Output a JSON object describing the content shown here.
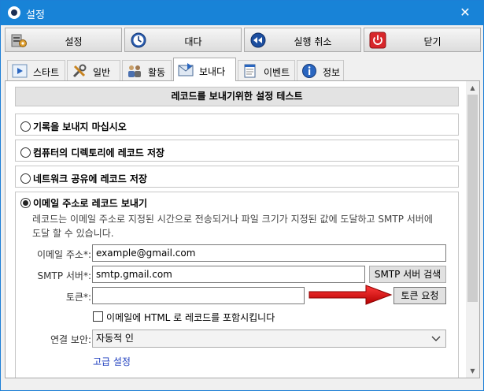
{
  "window": {
    "title": "설정",
    "close_glyph": "✕"
  },
  "toolbar": {
    "buttons": [
      {
        "label": "설정",
        "icon": "settings-icon"
      },
      {
        "label": "대다",
        "icon": "clock-icon"
      },
      {
        "label": "실행 취소",
        "icon": "rewind-icon"
      },
      {
        "label": "닫기",
        "icon": "power-icon"
      }
    ]
  },
  "tabs": [
    {
      "label": "스타트",
      "icon": "play-icon"
    },
    {
      "label": "일반",
      "icon": "tools-icon"
    },
    {
      "label": "활동",
      "icon": "users-icon"
    },
    {
      "label": "보내다",
      "icon": "mail-icon",
      "active": true
    },
    {
      "label": "이벤트",
      "icon": "notepad-icon"
    },
    {
      "label": "정보",
      "icon": "info-icon"
    }
  ],
  "panel": {
    "header": "레코드를 보내기위한 설정 테스트",
    "options": [
      {
        "label": "기록을 보내지 마십시오",
        "checked": false
      },
      {
        "label": "컴퓨터의 디렉토리에 레코드 저장",
        "checked": false
      },
      {
        "label": "네트워크 공유에 레코드 저장",
        "checked": false
      },
      {
        "label": "이메일 주소로 레코드 보내기",
        "checked": true
      }
    ],
    "email_section": {
      "description": "레코드는 이메일 주소로 지정된 시간으로 전송되거나 파일 크기가 지정된 값에 도달하고 SMTP 서버에 도달 할 수 있습니다.",
      "email_label": "이메일 주소*:",
      "email_value": "example@gmail.com",
      "smtp_label": "SMTP 서버*:",
      "smtp_value": "smtp.gmail.com",
      "smtp_search_button": "SMTP 서버 검색",
      "token_label": "토큰*:",
      "token_value": "",
      "token_request_button": "토큰 요청",
      "html_checkbox_label": "이메일에 HTML 로 레코드를 포함시킵니다",
      "html_checkbox_checked": false,
      "security_label": "연결 보안:",
      "security_value": "자동적 인",
      "advanced_link": "고급 설정"
    }
  },
  "colors": {
    "titlebar": "#1883d7",
    "link": "#1f3fbf",
    "arrow": "#e00000"
  }
}
